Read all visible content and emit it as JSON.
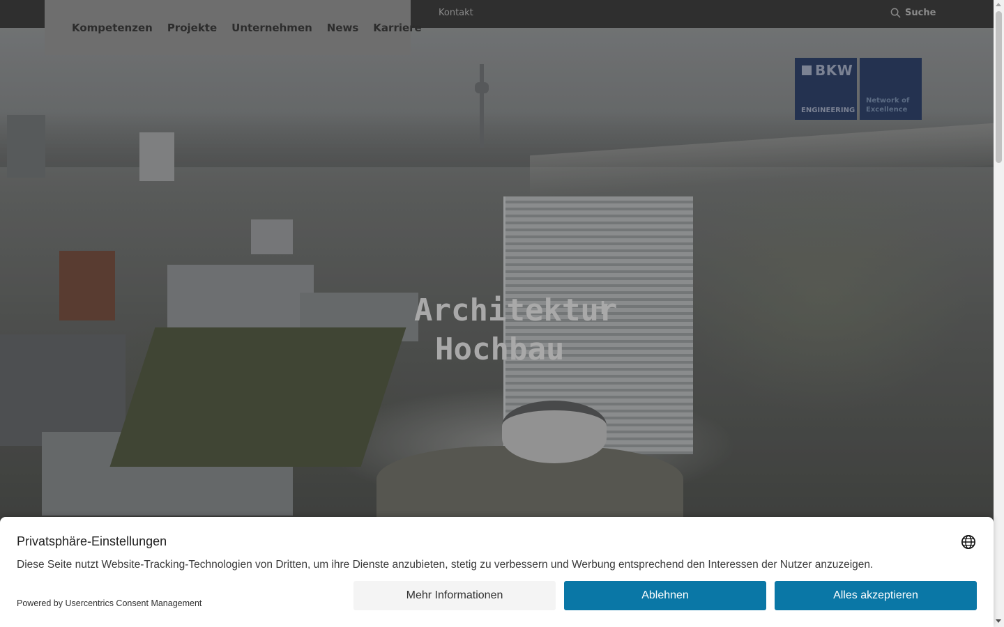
{
  "topbar": {
    "contact_label": "Kontakt",
    "search_label": "Suche"
  },
  "nav": {
    "items": [
      {
        "label": "Kompetenzen"
      },
      {
        "label": "Projekte"
      },
      {
        "label": "Unternehmen"
      },
      {
        "label": "News"
      },
      {
        "label": "Karriere"
      }
    ]
  },
  "logo": {
    "brand": "BKW",
    "engineering": "ENGINEERING",
    "network_line1": "Network of",
    "network_line2": "Excellence"
  },
  "hero": {
    "title_line1": "Architektur",
    "title_plus": "+",
    "title_line2": "Hochbau"
  },
  "consent": {
    "title": "Privatsphäre-Einstellungen",
    "text": "Diese Seite nutzt Website-Tracking-Technologien von Dritten, um ihre Dienste anzubieten, stetig zu verbessern und Werbung entsprechend den Interessen der Nutzer anzuzeigen.",
    "powered_by": "Powered by Usercentrics Consent Management",
    "more_info_label": "Mehr Informationen",
    "deny_label": "Ablehnen",
    "accept_label": "Alles akzeptieren"
  },
  "colors": {
    "topbar_bg": "#2f2f2f",
    "brand_navy": "#243250",
    "consent_primary": "#0a77a6"
  },
  "icons": [
    "search-icon",
    "globe-icon",
    "logo-mark-icon"
  ]
}
